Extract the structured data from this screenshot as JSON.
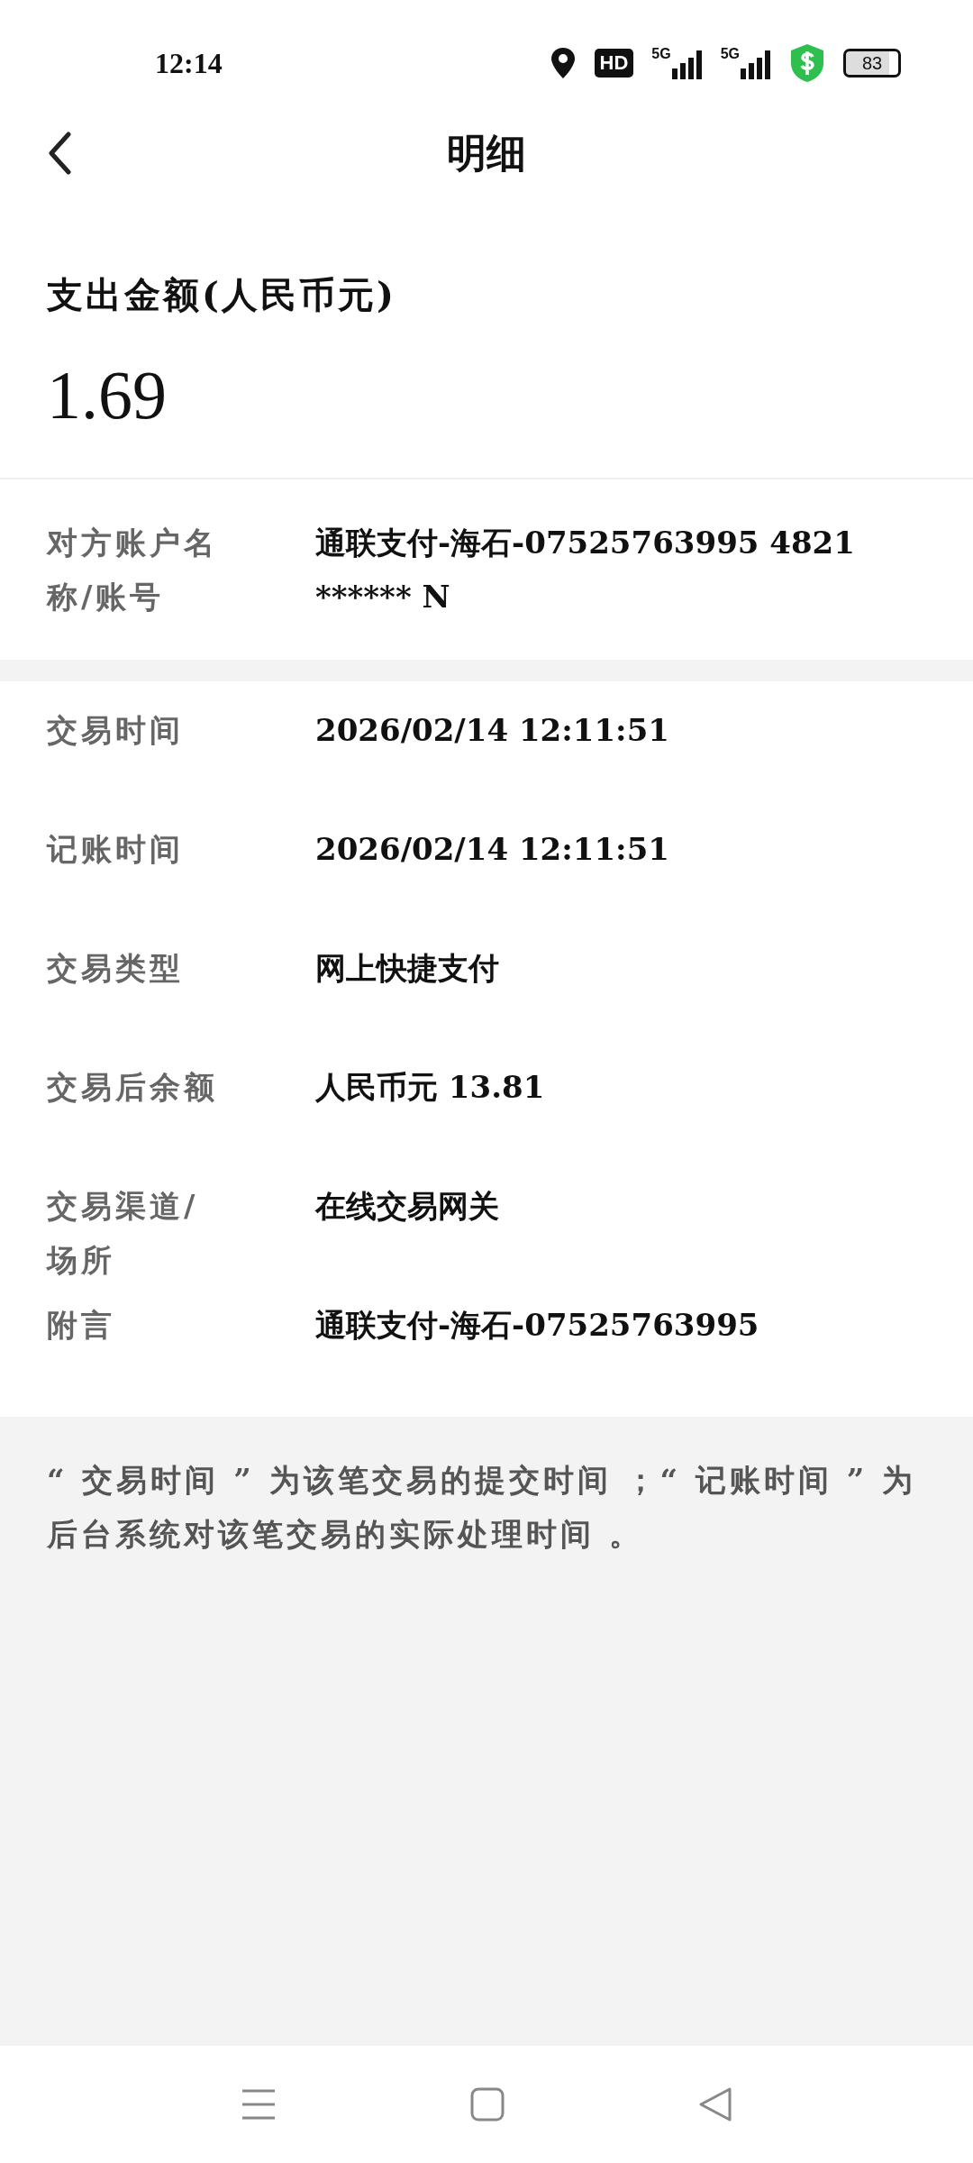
{
  "status_bar": {
    "time": "12:14",
    "hd": "HD",
    "network_1": "5G",
    "network_2": "5G",
    "battery": "83"
  },
  "header": {
    "title": "明细"
  },
  "amount": {
    "label": "支出金额(人民币元)",
    "value": "1.69"
  },
  "account": {
    "label": "对方账户名称/账号",
    "value": "通联支付-海石-07525763995 4821 ****** N"
  },
  "details": [
    {
      "label": "交易时间",
      "value": "2026/02/14 12:11:51"
    },
    {
      "label": "记账时间",
      "value": "2026/02/14 12:11:51"
    },
    {
      "label": "交易类型",
      "value": "网上快捷支付"
    },
    {
      "label": "交易后余额",
      "value": "人民币元 13.81"
    },
    {
      "label": "交易渠道/场所",
      "value": "在线交易网关"
    },
    {
      "label": "附言",
      "value": "通联支付-海石-07525763995"
    }
  ],
  "note": "“ 交易时间 ” 为该笔交易的提交时间 ；“ 记账时间 ” 为后台系统对该笔交易的实际处理时间 。"
}
